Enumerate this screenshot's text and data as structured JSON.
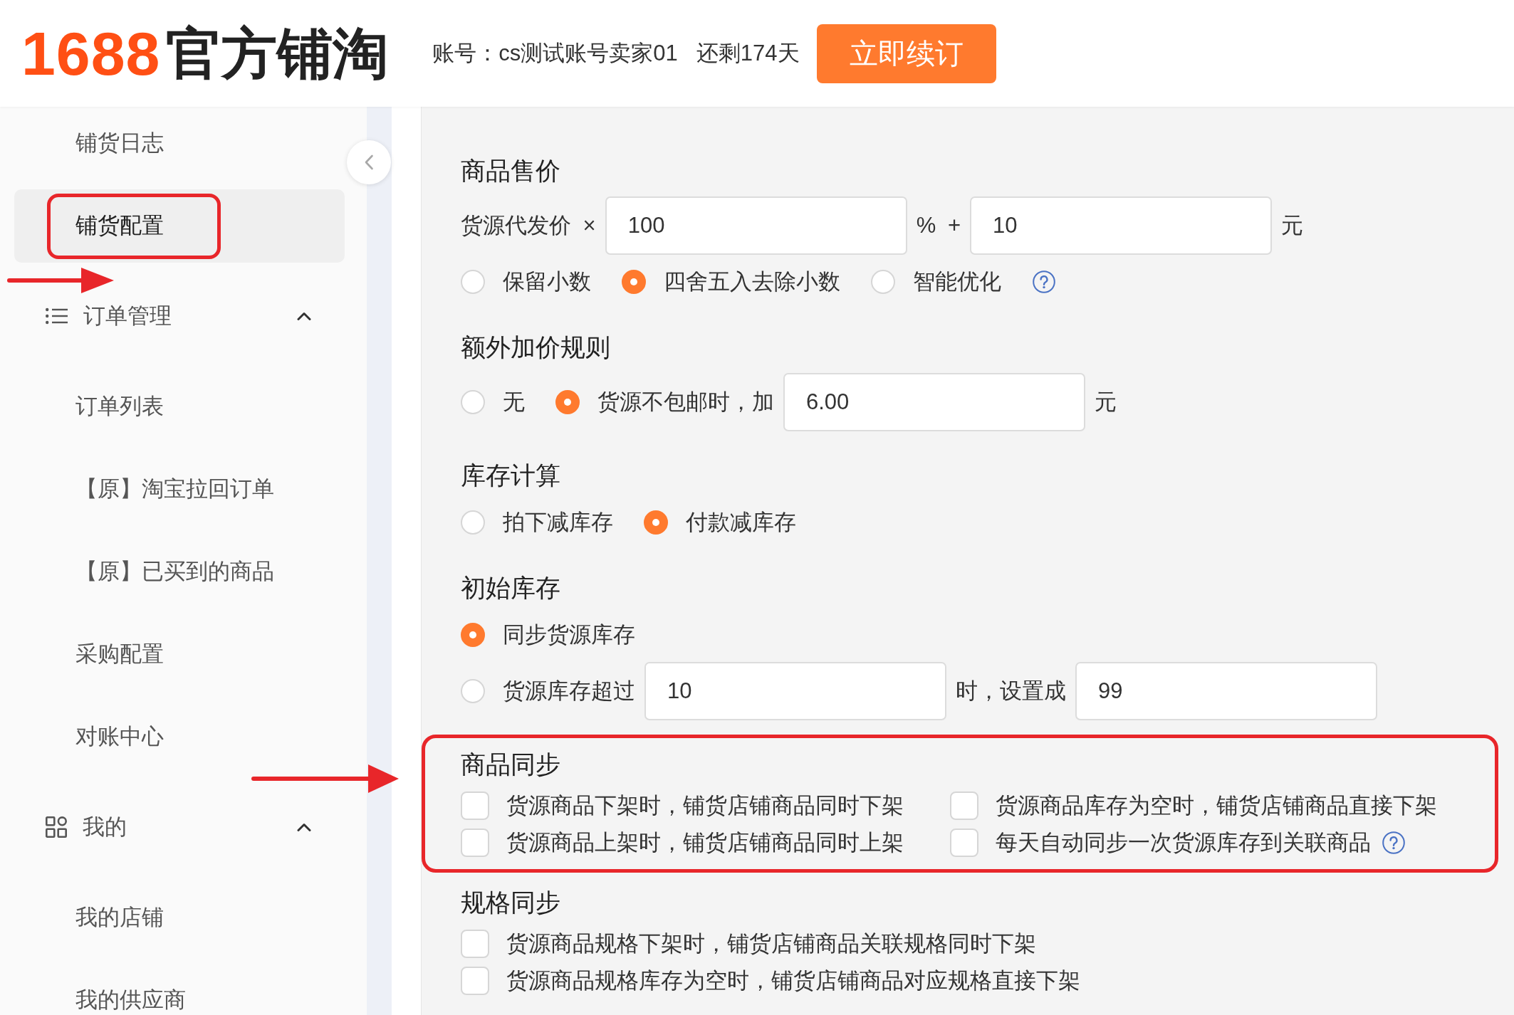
{
  "header": {
    "logo_number": "1688",
    "logo_title": "官方铺淘",
    "account": "账号：cs测试账号卖家01",
    "remaining": "还剩174天",
    "renew_button": "立即续订"
  },
  "sidebar": {
    "items": [
      {
        "kind": "link",
        "label": "铺货日志",
        "selected": false
      },
      {
        "kind": "link",
        "label": "铺货配置",
        "selected": true,
        "annotated": true
      },
      {
        "kind": "group",
        "label": "订单管理",
        "expanded": true,
        "children": [
          {
            "label": "订单列表",
            "selected": false
          },
          {
            "label": "【原】淘宝拉回订单",
            "selected": false
          },
          {
            "label": "【原】已买到的商品",
            "selected": false
          },
          {
            "label": "采购配置",
            "selected": false
          },
          {
            "label": "对账中心",
            "selected": false
          }
        ]
      },
      {
        "kind": "group",
        "label": "我的",
        "expanded": true,
        "children": [
          {
            "label": "我的店铺",
            "selected": false
          },
          {
            "label": "我的供应商",
            "selected": false
          }
        ]
      }
    ]
  },
  "sections": [
    {
      "title": "商品售价",
      "rows": [
        {
          "kind": "inline",
          "parts": [
            {
              "kind": "label",
              "text": "货源代发价 ×"
            },
            {
              "kind": "input",
              "value": "100"
            },
            {
              "kind": "label",
              "text": "% +"
            },
            {
              "kind": "input",
              "value": "10"
            },
            {
              "kind": "label",
              "text": "元"
            }
          ]
        },
        {
          "kind": "options",
          "parts": [
            {
              "kind": "radio",
              "label": "保留小数",
              "selected": false
            },
            {
              "kind": "radio",
              "label": "四舍五入去除小数",
              "selected": true
            },
            {
              "kind": "radio",
              "label": "智能优化",
              "selected": false,
              "help": true
            }
          ]
        }
      ]
    },
    {
      "title": "额外加价规则",
      "rows": [
        {
          "kind": "inline",
          "parts": [
            {
              "kind": "radio",
              "label": "无",
              "selected": false
            },
            {
              "kind": "radio",
              "label": "货源不包邮时，加",
              "selected": true
            },
            {
              "kind": "input",
              "value": "6.00"
            },
            {
              "kind": "label",
              "text": "元"
            }
          ]
        }
      ]
    },
    {
      "title": "库存计算",
      "rows": [
        {
          "kind": "options",
          "parts": [
            {
              "kind": "radio",
              "label": "拍下减库存",
              "selected": false
            },
            {
              "kind": "radio",
              "label": "付款减库存",
              "selected": true
            }
          ]
        }
      ]
    },
    {
      "title": "初始库存",
      "rows": [
        {
          "kind": "options",
          "parts": [
            {
              "kind": "radio",
              "label": "同步货源库存",
              "selected": true
            }
          ]
        },
        {
          "kind": "inline",
          "parts": [
            {
              "kind": "radio",
              "label": "货源库存超过",
              "selected": false
            },
            {
              "kind": "input",
              "value": "10"
            },
            {
              "kind": "label",
              "text": "时，设置成"
            },
            {
              "kind": "input",
              "value": "99"
            }
          ]
        }
      ]
    },
    {
      "title": "商品同步",
      "annotated": true,
      "rows": [
        {
          "kind": "grid",
          "parts": [
            {
              "kind": "checkbox",
              "label": "货源商品下架时，铺货店铺商品同时下架",
              "checked": false
            },
            {
              "kind": "checkbox",
              "label": "货源商品库存为空时，铺货店铺商品直接下架",
              "checked": false
            }
          ]
        },
        {
          "kind": "grid",
          "parts": [
            {
              "kind": "checkbox",
              "label": "货源商品上架时，铺货店铺商品同时上架",
              "checked": false
            },
            {
              "kind": "checkbox",
              "label": "每天自动同步一次货源库存到关联商品",
              "checked": false,
              "help": true
            }
          ]
        }
      ]
    },
    {
      "title": "规格同步",
      "rows": [
        {
          "kind": "grid",
          "parts": [
            {
              "kind": "checkbox",
              "label": "货源商品规格下架时，铺货店铺商品关联规格同时下架",
              "checked": false
            }
          ]
        },
        {
          "kind": "grid",
          "parts": [
            {
              "kind": "checkbox",
              "label": "货源商品规格库存为空时，铺货店铺商品对应规格直接下架",
              "checked": false
            }
          ]
        }
      ]
    }
  ]
}
